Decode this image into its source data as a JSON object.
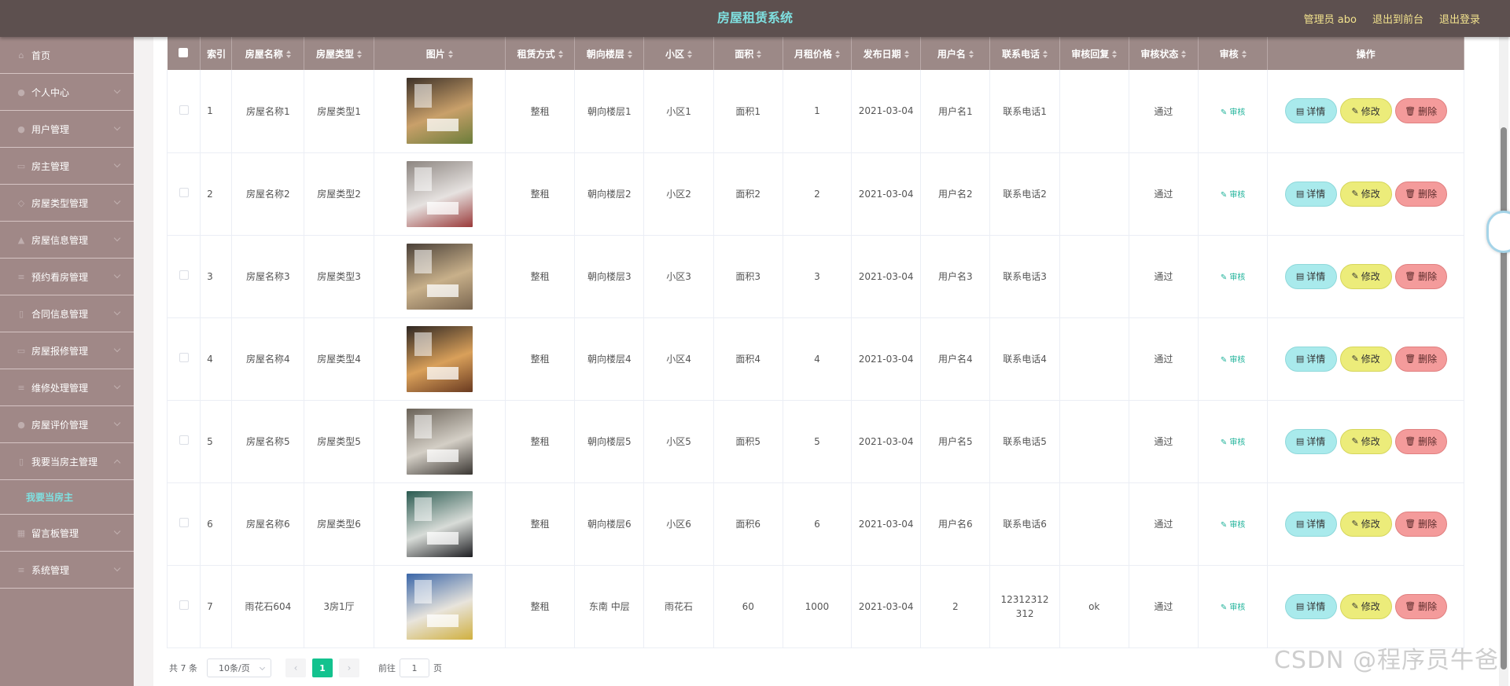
{
  "header": {
    "title": "房屋租赁系统",
    "admin_label": "管理员 abo",
    "to_front_label": "退出到前台",
    "logout_label": "退出登录"
  },
  "sidebar": {
    "items": [
      {
        "label": "首页",
        "icon": "home-icon"
      },
      {
        "label": "个人中心",
        "icon": "user-icon"
      },
      {
        "label": "用户管理",
        "icon": "users-icon"
      },
      {
        "label": "房主管理",
        "icon": "card-icon"
      },
      {
        "label": "房屋类型管理",
        "icon": "tag-icon"
      },
      {
        "label": "房屋信息管理",
        "icon": "house-icon"
      },
      {
        "label": "预约看房管理",
        "icon": "list-icon"
      },
      {
        "label": "合同信息管理",
        "icon": "doc-icon"
      },
      {
        "label": "房屋报修管理",
        "icon": "tool-icon"
      },
      {
        "label": "维修处理管理",
        "icon": "wrench-icon"
      },
      {
        "label": "房屋评价管理",
        "icon": "star-icon"
      },
      {
        "label": "我要当房主管理",
        "icon": "key-icon"
      },
      {
        "label": "留言板管理",
        "icon": "message-icon"
      },
      {
        "label": "系统管理",
        "icon": "gear-icon"
      }
    ],
    "submenu_active": "我要当房主"
  },
  "table": {
    "columns": [
      "索引",
      "房屋名称",
      "房屋类型",
      "图片",
      "租赁方式",
      "朝向楼层",
      "小区",
      "面积",
      "月租价格",
      "发布日期",
      "用户名",
      "联系电话",
      "审核回复",
      "审核状态",
      "审核",
      "操作"
    ],
    "rows": [
      {
        "index": "1",
        "name": "房屋名称1",
        "type": "房屋类型1",
        "mode": "整租",
        "floor": "朝向楼层1",
        "community": "小区1",
        "area": "面积1",
        "price": "1",
        "date": "2021-03-04",
        "username": "用户名1",
        "phone": "联系电话1",
        "reply": "",
        "status": "通过",
        "image_palette": [
          "#3d3128",
          "#c9a06a",
          "#6b7d3a"
        ]
      },
      {
        "index": "2",
        "name": "房屋名称2",
        "type": "房屋类型2",
        "mode": "整租",
        "floor": "朝向楼层2",
        "community": "小区2",
        "area": "面积2",
        "price": "2",
        "date": "2021-03-04",
        "username": "用户名2",
        "phone": "联系电话2",
        "reply": "",
        "status": "通过",
        "image_palette": [
          "#8c8580",
          "#e6e2e0",
          "#9a3a3a"
        ]
      },
      {
        "index": "3",
        "name": "房屋名称3",
        "type": "房屋类型3",
        "mode": "整租",
        "floor": "朝向楼层3",
        "community": "小区3",
        "area": "面积3",
        "price": "3",
        "date": "2021-03-04",
        "username": "用户名3",
        "phone": "联系电话3",
        "reply": "",
        "status": "通过",
        "image_palette": [
          "#4a4038",
          "#c8b08a",
          "#7a6650"
        ]
      },
      {
        "index": "4",
        "name": "房屋名称4",
        "type": "房屋类型4",
        "mode": "整租",
        "floor": "朝向楼层4",
        "community": "小区4",
        "area": "面积4",
        "price": "4",
        "date": "2021-03-04",
        "username": "用户名4",
        "phone": "联系电话4",
        "reply": "",
        "status": "通过",
        "image_palette": [
          "#2e2622",
          "#d9a05a",
          "#6a3a20"
        ]
      },
      {
        "index": "5",
        "name": "房屋名称5",
        "type": "房屋类型5",
        "mode": "整租",
        "floor": "朝向楼层5",
        "community": "小区5",
        "area": "面积5",
        "price": "5",
        "date": "2021-03-04",
        "username": "用户名5",
        "phone": "联系电话5",
        "reply": "",
        "status": "通过",
        "image_palette": [
          "#6a6258",
          "#d4cfc6",
          "#3a3632"
        ]
      },
      {
        "index": "6",
        "name": "房屋名称6",
        "type": "房屋类型6",
        "mode": "整租",
        "floor": "朝向楼层6",
        "community": "小区6",
        "area": "面积6",
        "price": "6",
        "date": "2021-03-04",
        "username": "用户名6",
        "phone": "联系电话6",
        "reply": "",
        "status": "通过",
        "image_palette": [
          "#2a5a50",
          "#d8dcd8",
          "#1e1e22"
        ]
      },
      {
        "index": "7",
        "name": "雨花石604",
        "type": "3房1厅",
        "mode": "整租",
        "floor": "东南 中层",
        "community": "雨花石",
        "area": "60",
        "price": "1000",
        "date": "2021-03-04",
        "username": "2",
        "phone": "12312312312",
        "reply": "ok",
        "status": "通过",
        "image_palette": [
          "#3a66a8",
          "#e8e4dc",
          "#d0b040"
        ]
      }
    ],
    "audit_label": "审核",
    "detail_label": "详情",
    "edit_label": "修改",
    "delete_label": "删除"
  },
  "pagination": {
    "total": "共 7 条",
    "page_size": "10条/页",
    "prev": "‹",
    "current_page": "1",
    "next": "›",
    "goto_label": "前往",
    "goto_value": "1",
    "page_suffix": "页"
  },
  "watermark": "CSDN @程序员牛爸",
  "colors": {
    "header_bg": "#5d504f",
    "title": "#7fe0e0",
    "header_links": "#f3e38e",
    "sidebar_bg": "#a08887",
    "table_header_bg": "#9c8987",
    "active_page": "#13c28e"
  }
}
